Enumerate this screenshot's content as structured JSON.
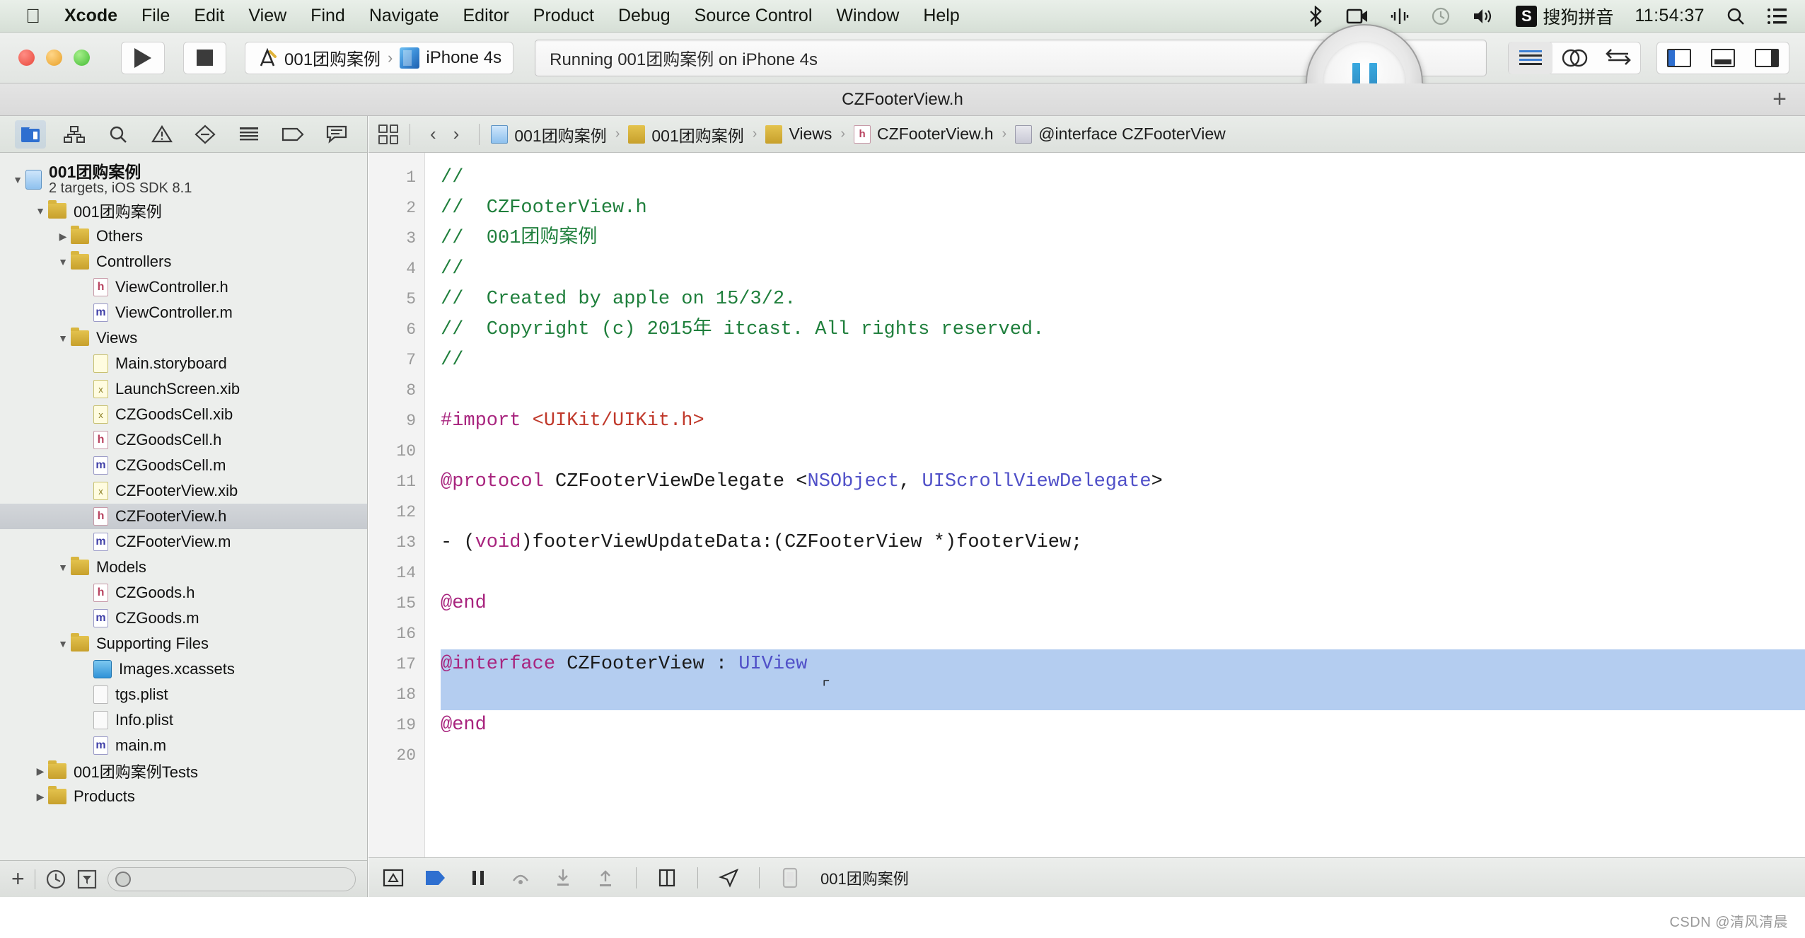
{
  "menubar": {
    "apple_icon": "apple-logo-icon",
    "items": [
      "Xcode",
      "File",
      "Edit",
      "View",
      "Find",
      "Navigate",
      "Editor",
      "Product",
      "Debug",
      "Source Control",
      "Window",
      "Help"
    ],
    "status_items": [
      {
        "name": "bluetooth-icon",
        "label": ""
      },
      {
        "name": "screen-record-icon",
        "label": ""
      },
      {
        "name": "airdrop-icon",
        "label": ""
      },
      {
        "name": "time-machine-icon",
        "label": ""
      },
      {
        "name": "volume-icon",
        "label": ""
      }
    ],
    "input_method_badge": "S",
    "input_method_label": "搜狗拼音",
    "clock": "11:54:37",
    "search_icon": "spotlight-search-icon",
    "notification_icon": "notification-center-icon"
  },
  "toolbar": {
    "run_button": "run-button",
    "stop_button": "stop-button",
    "scheme_name": "001团购案例",
    "scheme_separator": "›",
    "destination": "iPhone 4s",
    "activity_status": "Running 001团购案例 on iPhone 4s",
    "pause_button": "pause-button",
    "editor_modes": [
      "standard-editor",
      "assistant-editor",
      "version-editor"
    ],
    "view_toggles": [
      "navigator-toggle",
      "debug-area-toggle",
      "utilities-toggle"
    ]
  },
  "document": {
    "title": "CZFooterView.h",
    "add_tab": "+"
  },
  "navigator": {
    "tabs": [
      {
        "name": "project-navigator",
        "active": true
      },
      {
        "name": "symbol-navigator",
        "active": false
      },
      {
        "name": "find-navigator",
        "active": false
      },
      {
        "name": "issue-navigator",
        "active": false
      },
      {
        "name": "test-navigator",
        "active": false
      },
      {
        "name": "debug-navigator",
        "active": false
      },
      {
        "name": "breakpoint-navigator",
        "active": false
      },
      {
        "name": "report-navigator",
        "active": false
      }
    ],
    "tree": [
      {
        "label": "001团购案例",
        "sub": "2 targets, iOS SDK 8.1",
        "icon": "project-icon",
        "indent": 0,
        "twisty": "down",
        "selected": false
      },
      {
        "label": "001团购案例",
        "sub": "",
        "icon": "folder-icon",
        "indent": 1,
        "twisty": "down",
        "selected": false
      },
      {
        "label": "Others",
        "sub": "",
        "icon": "folder-icon",
        "indent": 2,
        "twisty": "right",
        "selected": false
      },
      {
        "label": "Controllers",
        "sub": "",
        "icon": "folder-icon",
        "indent": 2,
        "twisty": "down",
        "selected": false
      },
      {
        "label": "ViewController.h",
        "sub": "",
        "icon": "header-file-icon",
        "indent": 3,
        "twisty": "",
        "selected": false
      },
      {
        "label": "ViewController.m",
        "sub": "",
        "icon": "source-file-icon",
        "indent": 3,
        "twisty": "",
        "selected": false
      },
      {
        "label": "Views",
        "sub": "",
        "icon": "folder-icon",
        "indent": 2,
        "twisty": "down",
        "selected": false
      },
      {
        "label": "Main.storyboard",
        "sub": "",
        "icon": "storyboard-icon",
        "indent": 3,
        "twisty": "",
        "selected": false
      },
      {
        "label": "LaunchScreen.xib",
        "sub": "",
        "icon": "xib-icon",
        "indent": 3,
        "twisty": "",
        "selected": false
      },
      {
        "label": "CZGoodsCell.xib",
        "sub": "",
        "icon": "xib-icon",
        "indent": 3,
        "twisty": "",
        "selected": false
      },
      {
        "label": "CZGoodsCell.h",
        "sub": "",
        "icon": "header-file-icon",
        "indent": 3,
        "twisty": "",
        "selected": false
      },
      {
        "label": "CZGoodsCell.m",
        "sub": "",
        "icon": "source-file-icon",
        "indent": 3,
        "twisty": "",
        "selected": false
      },
      {
        "label": "CZFooterView.xib",
        "sub": "",
        "icon": "xib-icon",
        "indent": 3,
        "twisty": "",
        "selected": false
      },
      {
        "label": "CZFooterView.h",
        "sub": "",
        "icon": "header-file-icon",
        "indent": 3,
        "twisty": "",
        "selected": true
      },
      {
        "label": "CZFooterView.m",
        "sub": "",
        "icon": "source-file-icon",
        "indent": 3,
        "twisty": "",
        "selected": false
      },
      {
        "label": "Models",
        "sub": "",
        "icon": "folder-icon",
        "indent": 2,
        "twisty": "down",
        "selected": false
      },
      {
        "label": "CZGoods.h",
        "sub": "",
        "icon": "header-file-icon",
        "indent": 3,
        "twisty": "",
        "selected": false
      },
      {
        "label": "CZGoods.m",
        "sub": "",
        "icon": "source-file-icon",
        "indent": 3,
        "twisty": "",
        "selected": false
      },
      {
        "label": "Supporting Files",
        "sub": "",
        "icon": "folder-icon",
        "indent": 2,
        "twisty": "down",
        "selected": false
      },
      {
        "label": "Images.xcassets",
        "sub": "",
        "icon": "assets-icon",
        "indent": 3,
        "twisty": "",
        "selected": false
      },
      {
        "label": "tgs.plist",
        "sub": "",
        "icon": "plist-icon",
        "indent": 3,
        "twisty": "",
        "selected": false
      },
      {
        "label": "Info.plist",
        "sub": "",
        "icon": "plist-icon",
        "indent": 3,
        "twisty": "",
        "selected": false
      },
      {
        "label": "main.m",
        "sub": "",
        "icon": "source-file-icon",
        "indent": 3,
        "twisty": "",
        "selected": false
      },
      {
        "label": "001团购案例Tests",
        "sub": "",
        "icon": "folder-icon",
        "indent": 1,
        "twisty": "right",
        "selected": false
      },
      {
        "label": "Products",
        "sub": "",
        "icon": "folder-icon",
        "indent": 1,
        "twisty": "right",
        "selected": false
      }
    ],
    "footer": {
      "add_button": "+",
      "recent_icon": "recent-files-icon",
      "filter_icon": "source-control-filter-icon",
      "search_placeholder": ""
    }
  },
  "breadcrumb": {
    "related_files_icon": "related-files-icon",
    "back_arrow": "‹",
    "forward_arrow": "›",
    "items": [
      {
        "label": "001团购案例",
        "icon": "project-icon"
      },
      {
        "label": "001团购案例",
        "icon": "folder-icon"
      },
      {
        "label": "Views",
        "icon": "folder-icon"
      },
      {
        "label": "CZFooterView.h",
        "icon": "header-file-icon"
      },
      {
        "label": "@interface CZFooterView",
        "icon": "interface-symbol-icon"
      }
    ],
    "separator": "›"
  },
  "editor": {
    "line_numbers": [
      "1",
      "2",
      "3",
      "4",
      "5",
      "6",
      "7",
      "8",
      "9",
      "10",
      "11",
      "12",
      "13",
      "14",
      "15",
      "16",
      "17",
      "18",
      "19",
      "20"
    ],
    "error_line": "13",
    "error_marker": "!",
    "selection_lines": [
      "17",
      "18",
      "19"
    ],
    "lines": [
      {
        "n": "1",
        "text": "//"
      },
      {
        "n": "2",
        "text": "//  CZFooterView.h"
      },
      {
        "n": "3",
        "text": "//  001团购案例"
      },
      {
        "n": "4",
        "text": "//"
      },
      {
        "n": "5",
        "text": "//  Created by apple on 15/3/2."
      },
      {
        "n": "6",
        "text": "//  Copyright (c) 2015年 itcast. All rights reserved."
      },
      {
        "n": "7",
        "text": "//"
      },
      {
        "n": "8",
        "text": ""
      },
      {
        "n": "9",
        "text": "#import <UIKit/UIKit.h>"
      },
      {
        "n": "10",
        "text": ""
      },
      {
        "n": "11",
        "text": "@protocol CZFooterViewDelegate <NSObject, UIScrollViewDelegate>"
      },
      {
        "n": "12",
        "text": ""
      },
      {
        "n": "13",
        "text": "- (void)footerViewUpdateData:(CZFooterView *)footerView;"
      },
      {
        "n": "14",
        "text": ""
      },
      {
        "n": "15",
        "text": "@end"
      },
      {
        "n": "16",
        "text": ""
      },
      {
        "n": "17",
        "text": "@interface CZFooterView : UIView"
      },
      {
        "n": "18",
        "text": ""
      },
      {
        "n": "19",
        "text": "@end"
      },
      {
        "n": "20",
        "text": ""
      }
    ]
  },
  "debugbar": {
    "icons": [
      {
        "name": "hide-debug-area-icon"
      },
      {
        "name": "continue-icon"
      },
      {
        "name": "pause-execution-icon"
      },
      {
        "name": "step-over-icon"
      },
      {
        "name": "step-into-icon"
      },
      {
        "name": "step-out-icon"
      },
      {
        "name": "view-hierarchy-icon"
      },
      {
        "name": "simulate-location-icon"
      }
    ],
    "process_icon": "process-icon",
    "process_label": "001团购案例"
  },
  "watermark": "CSDN @清风清晨",
  "colors": {
    "comment_green": "#1f7f3c",
    "keyword_magenta": "#a8247e",
    "string_red": "#c0392b",
    "type_purple": "#5050c8",
    "selection_blue": "#b4cdf0",
    "error_red": "#d62314",
    "accent_blue": "#2e6fd0"
  }
}
